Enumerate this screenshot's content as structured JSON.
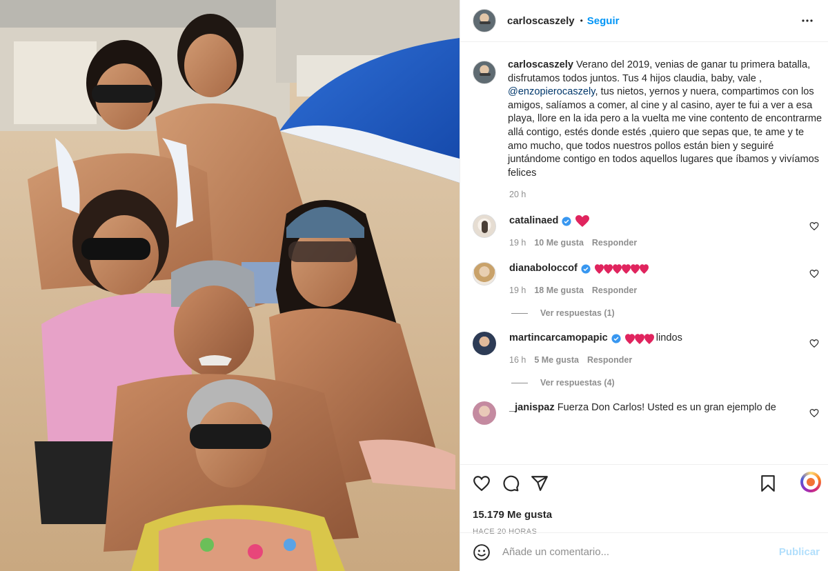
{
  "post": {
    "username": "carloscaszely",
    "follow_label": "Seguir",
    "separator": "•"
  },
  "caption": {
    "username": "carloscaszely",
    "text_before": "Verano del 2019, venias de ganar tu primera batalla, disfrutamos todos juntos. Tus 4 hijos claudia, baby, vale , ",
    "mention": "@enzopierocaszely",
    "text_after": ", tus nietos, yernos y nuera, compartimos con los amigos, salíamos a comer, al cine y al casino, ayer te fui a ver a esa playa, llore en la ida pero a la vuelta me vine contento de encontrarme allá contigo, estés donde estés ,quiero que sepas que, te ame y te amo mucho, que todos nuestros pollos están bien y seguiré juntándome contigo en todos aquellos lugares que íbamos y vivíamos felices",
    "time": "20 h"
  },
  "comments": [
    {
      "username": "catalinaed",
      "verified": true,
      "text": "",
      "hearts": 1,
      "time": "19 h",
      "likes": "10 Me gusta",
      "reply": "Responder",
      "view_replies": ""
    },
    {
      "username": "dianaboloccof",
      "verified": true,
      "text": "",
      "hearts": 6,
      "time": "19 h",
      "likes": "18 Me gusta",
      "reply": "Responder",
      "view_replies": "Ver respuestas (1)"
    },
    {
      "username": "martincarcamopapic",
      "verified": true,
      "text": "lindos",
      "hearts": 3,
      "time": "16 h",
      "likes": "5 Me gusta",
      "reply": "Responder",
      "view_replies": "Ver respuestas (4)"
    },
    {
      "username": "_janispaz",
      "verified": false,
      "text": "Fuerza Don Carlos! Usted es un gran ejemplo de",
      "hearts": 0
    }
  ],
  "stats": {
    "likes": "15.179 Me gusta",
    "posted": "HACE 20 HORAS"
  },
  "comment_box": {
    "placeholder": "Añade un comentario...",
    "publish_label": "Publicar"
  },
  "icons": {
    "more": "more-dots-icon",
    "like": "heart-outline-icon",
    "comment": "comment-bubble-icon",
    "share": "paper-plane-icon",
    "save": "bookmark-icon",
    "emoji": "emoji-smile-icon",
    "verified": "verified-badge-icon",
    "heart_emoji": "red-heart-emoji"
  },
  "colors": {
    "accent": "#0095f6",
    "link": "#00376b",
    "muted": "#8e8e8e",
    "heart": "#e0245e",
    "publish_disabled": "#b2dffc"
  }
}
